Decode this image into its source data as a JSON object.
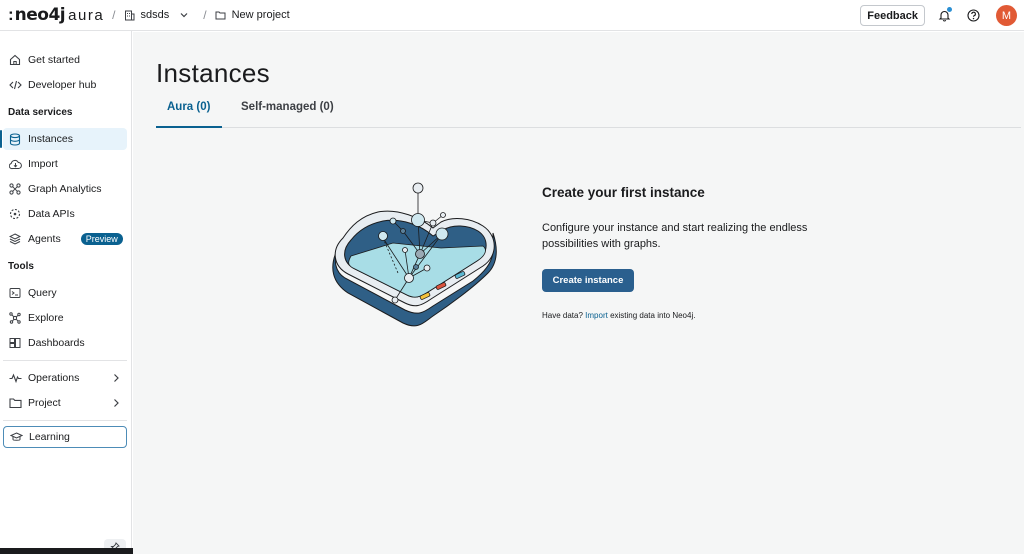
{
  "brand": {
    "name": "neo4j",
    "product": "aura"
  },
  "breadcrumb": {
    "org": "sdsds",
    "project": "New project"
  },
  "header": {
    "feedback_label": "Feedback",
    "avatar_initial": "M"
  },
  "sidebar": {
    "items_top": [
      {
        "label": "Get started",
        "icon": "home-icon"
      },
      {
        "label": "Developer hub",
        "icon": "code-icon"
      }
    ],
    "section_data_services": "Data services",
    "items_data": [
      {
        "label": "Instances",
        "icon": "database-icon",
        "active": true
      },
      {
        "label": "Import",
        "icon": "import-icon"
      },
      {
        "label": "Graph Analytics",
        "icon": "graph-analytics-icon"
      },
      {
        "label": "Data APIs",
        "icon": "data-apis-icon"
      },
      {
        "label": "Agents",
        "icon": "agents-icon",
        "badge": "Preview"
      }
    ],
    "section_tools": "Tools",
    "items_tools": [
      {
        "label": "Query",
        "icon": "terminal-icon"
      },
      {
        "label": "Explore",
        "icon": "explore-icon"
      },
      {
        "label": "Dashboards",
        "icon": "dashboard-icon"
      }
    ],
    "items_bottom": [
      {
        "label": "Operations",
        "icon": "pulse-icon"
      },
      {
        "label": "Project",
        "icon": "folder-icon"
      }
    ],
    "learning": {
      "label": "Learning",
      "icon": "graduation-cap-icon"
    }
  },
  "main": {
    "title": "Instances",
    "tabs": [
      {
        "label": "Aura (0)",
        "active": true
      },
      {
        "label": "Self-managed (0)",
        "active": false
      }
    ],
    "empty_state": {
      "title": "Create your first instance",
      "description": "Configure your instance and start realizing the endless possibilities with graphs.",
      "button_label": "Create instance",
      "import_prefix": "Have data?",
      "import_link": "Import",
      "import_suffix": "existing data into Neo4j."
    }
  },
  "colors": {
    "accent": "#0a6190",
    "button": "#2a5f8e",
    "avatar": "#e15a35"
  }
}
